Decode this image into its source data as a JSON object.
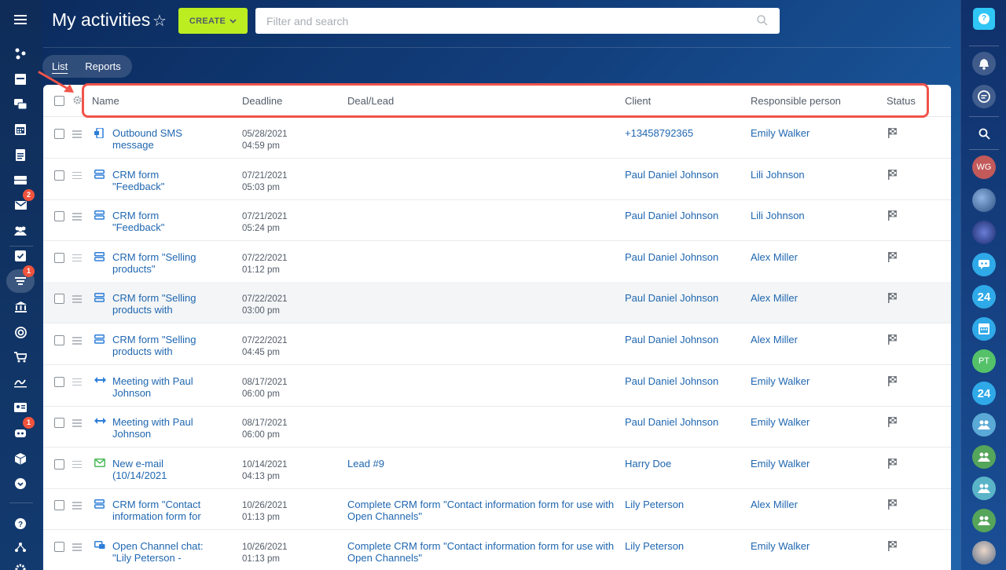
{
  "header": {
    "title": "My activities",
    "create_label": "CREATE",
    "search_placeholder": "Filter and search"
  },
  "tabs": [
    {
      "label": "List",
      "active": true
    },
    {
      "label": "Reports",
      "active": false
    }
  ],
  "columns": {
    "name": "Name",
    "deadline": "Deadline",
    "deal": "Deal/Lead",
    "client": "Client",
    "responsible": "Responsible person",
    "status": "Status"
  },
  "rows": [
    {
      "icon": "sms-icon",
      "name": "Outbound SMS message",
      "date": "05/28/2021",
      "time": "04:59 pm",
      "deal": "",
      "client": "+13458792365",
      "responsible": "Emily Walker"
    },
    {
      "icon": "form-icon",
      "name": "CRM form \"Feedback\"",
      "date": "07/21/2021",
      "time": "05:03 pm",
      "deal": "",
      "client": "Paul Daniel Johnson",
      "responsible": "Lili Johnson"
    },
    {
      "icon": "form-icon",
      "name": "CRM form \"Feedback\"",
      "date": "07/21/2021",
      "time": "05:24 pm",
      "deal": "",
      "client": "Paul Daniel Johnson",
      "responsible": "Lili Johnson"
    },
    {
      "icon": "form-icon",
      "name": "CRM form \"Selling products\"",
      "date": "07/22/2021",
      "time": "01:12 pm",
      "deal": "",
      "client": "Paul Daniel Johnson",
      "responsible": "Alex Miller"
    },
    {
      "icon": "form-icon",
      "name": "CRM form \"Selling products with",
      "date": "07/22/2021",
      "time": "03:00 pm",
      "deal": "",
      "client": "Paul Daniel Johnson",
      "responsible": "Alex Miller"
    },
    {
      "icon": "form-icon",
      "name": "CRM form \"Selling products with",
      "date": "07/22/2021",
      "time": "04:45 pm",
      "deal": "",
      "client": "Paul Daniel Johnson",
      "responsible": "Alex Miller"
    },
    {
      "icon": "meeting-icon",
      "name": "Meeting with Paul Johnson",
      "date": "08/17/2021",
      "time": "06:00 pm",
      "deal": "",
      "client": "Paul Daniel Johnson",
      "responsible": "Emily Walker"
    },
    {
      "icon": "meeting-icon",
      "name": "Meeting with Paul Johnson",
      "date": "08/17/2021",
      "time": "06:00 pm",
      "deal": "",
      "client": "Paul Daniel Johnson",
      "responsible": "Emily Walker"
    },
    {
      "icon": "email-icon",
      "name": "New e-mail (10/14/2021",
      "date": "10/14/2021",
      "time": "04:13 pm",
      "deal": "Lead #9",
      "client": "Harry Doe",
      "responsible": "Emily Walker"
    },
    {
      "icon": "form-icon",
      "name": "CRM form \"Contact information form for",
      "date": "10/26/2021",
      "time": "01:13 pm",
      "deal": "Complete CRM form \"Contact information form for use with Open Channels\"",
      "client": "Lily Peterson",
      "responsible": "Alex Miller"
    },
    {
      "icon": "chat-icon",
      "name": "Open Channel chat: \"Lily Peterson -",
      "date": "10/26/2021",
      "time": "01:13 pm",
      "deal": "Complete CRM form \"Contact information form for use with Open Channels\"",
      "client": "Lily Peterson",
      "responsible": "Emily Walker"
    }
  ],
  "left_sidebar": {
    "badges": {
      "mail": "2",
      "activities": "1",
      "robot": "1"
    }
  },
  "right_panel": {
    "help_label": "?",
    "avatar_wg": "WG",
    "avatar_pt": "PT",
    "b24_label_1": "24",
    "b24_label_2": "24"
  }
}
